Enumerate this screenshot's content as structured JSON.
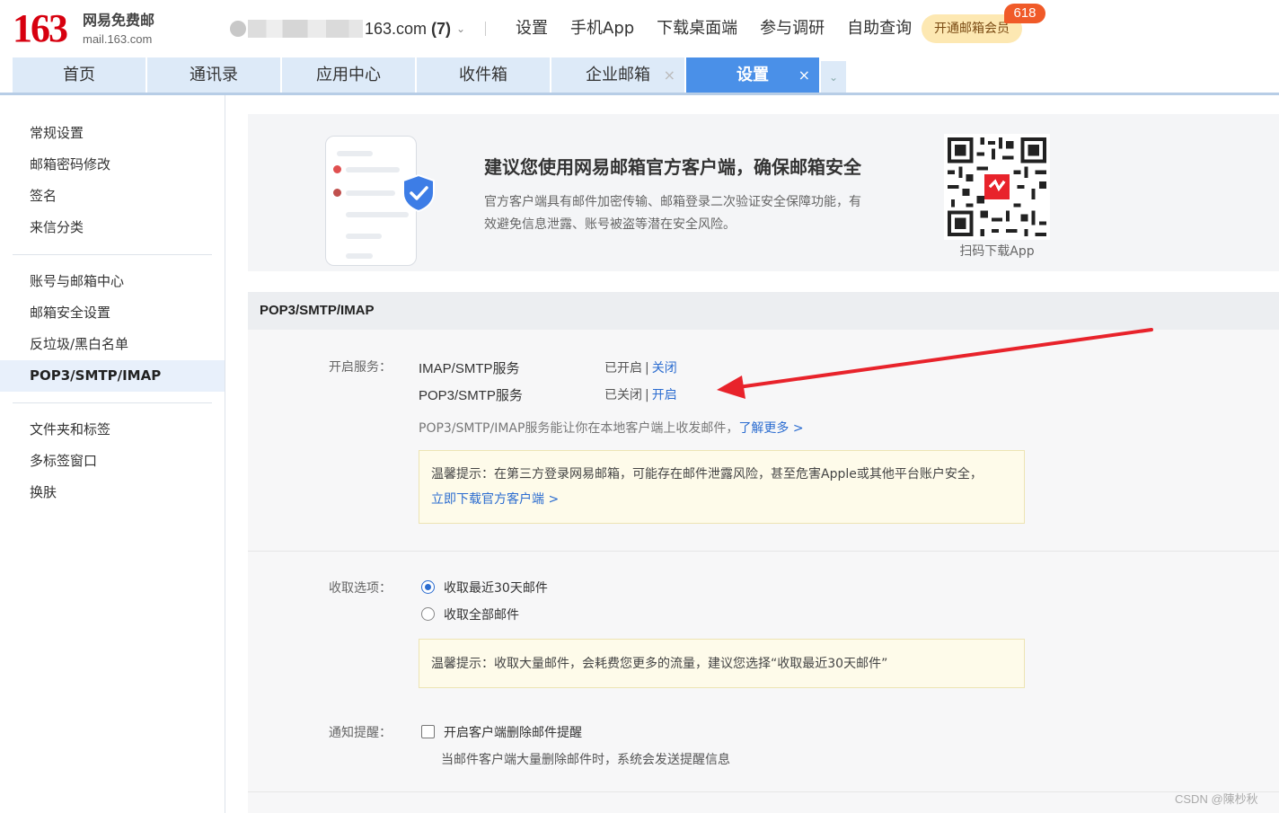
{
  "header": {
    "logo_num": "163",
    "logo_cn": "网易免费邮",
    "logo_en": "mail.163.com",
    "account_suffix": "163.com",
    "account_count": "(7)",
    "nav": [
      "设置",
      "手机App",
      "下载桌面端",
      "参与调研",
      "自助查询"
    ],
    "vip_label": "开通邮箱会员",
    "vip_badge": "618"
  },
  "tabs": [
    {
      "label": "首页"
    },
    {
      "label": "通讯录"
    },
    {
      "label": "应用中心"
    },
    {
      "label": "收件箱"
    },
    {
      "label": "企业邮箱"
    },
    {
      "label": "设置"
    }
  ],
  "sidebar": {
    "group1": [
      "常规设置",
      "邮箱密码修改",
      "签名",
      "来信分类"
    ],
    "group2": [
      "账号与邮箱中心",
      "邮箱安全设置",
      "反垃圾/黑白名单",
      "POP3/SMTP/IMAP"
    ],
    "group3": [
      "文件夹和标签",
      "多标签窗口",
      "换肤"
    ]
  },
  "banner": {
    "title": "建议您使用网易邮箱官方客户端，确保邮箱安全",
    "desc": "官方客户端具有邮件加密传输、邮箱登录二次验证安全保障功能，有效避免信息泄露、账号被盗等潜在安全风险。",
    "qr_caption": "扫码下载App"
  },
  "section": {
    "title": "POP3/SMTP/IMAP",
    "service_label": "开启服务：",
    "services": [
      {
        "name": "IMAP/SMTP服务",
        "status": "已开启",
        "action": "关闭"
      },
      {
        "name": "POP3/SMTP服务",
        "status": "已关闭",
        "action": "开启"
      }
    ],
    "service_info": "POP3/SMTP/IMAP服务能让你在本地客户端上收发邮件，",
    "service_info_link": "了解更多 >",
    "tip1_text": "温馨提示：在第三方登录网易邮箱，可能存在邮件泄露风险，甚至危害Apple或其他平台账户安全，",
    "tip1_link": "立即下载官方客户端 >",
    "fetch_label": "收取选项：",
    "fetch_options": [
      "收取最近30天邮件",
      "收取全部邮件"
    ],
    "fetch_selected": 0,
    "tip2_text": "温馨提示：收取大量邮件，会耗费您更多的流量，建议您选择“收取最近30天邮件”",
    "notify_label": "通知提醒：",
    "notify_option": "开启客户端删除邮件提醒",
    "notify_checked": false,
    "notify_note": "当邮件客户端大量删除邮件时，系统会发送提醒信息"
  },
  "watermark": "CSDN @陳杪秋",
  "colors": {
    "brand_red": "#d7000f",
    "tab_active": "#4a90e8",
    "link": "#2b6cd0",
    "arrow": "#e8232b"
  }
}
